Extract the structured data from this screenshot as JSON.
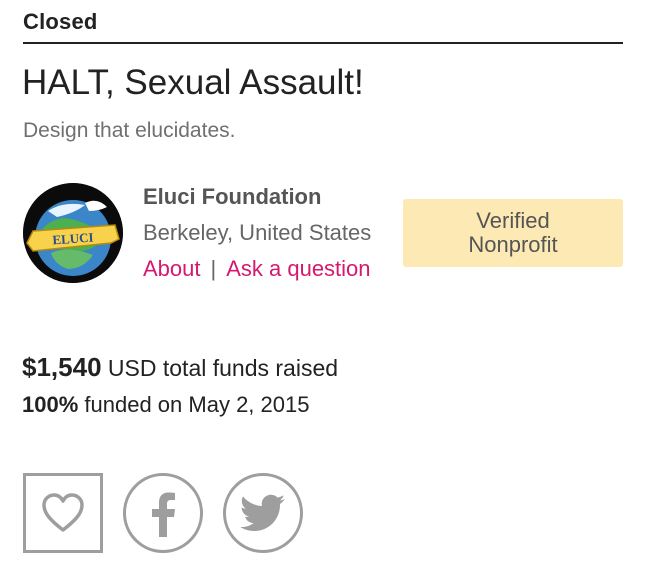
{
  "status": "Closed",
  "project": {
    "title": "HALT, Sexual Assault!",
    "tagline": "Design that elucidates."
  },
  "organization": {
    "avatar_text": "ELUCI",
    "name": "Eluci Foundation",
    "location": "Berkeley, United States",
    "links": {
      "about": "About",
      "separator": "|",
      "ask": "Ask a question"
    },
    "badge": "Verified Nonprofit"
  },
  "funding": {
    "amount": "$1,540",
    "amount_suffix": "USD total funds raised",
    "percent": "100%",
    "funded_suffix": "funded on May 2, 2015"
  },
  "share": {
    "icons": [
      "heart-icon",
      "facebook-icon",
      "twitter-icon"
    ]
  },
  "colors": {
    "accent": "#d6186f",
    "badge_bg": "#fde9b3",
    "icon_gray": "#9e9e9e"
  }
}
